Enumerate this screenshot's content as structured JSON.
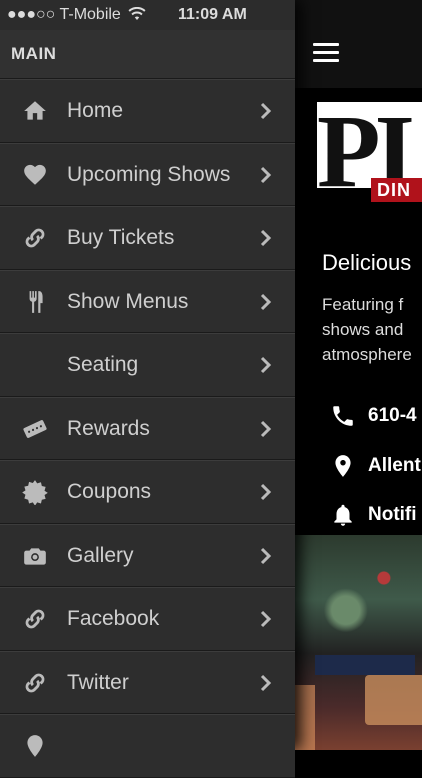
{
  "status_bar": {
    "carrier": "●●●○○ T-Mobile",
    "time": "11:09 AM"
  },
  "drawer": {
    "section_title": "MAIN",
    "items": [
      {
        "label": "Home",
        "icon": "home-icon"
      },
      {
        "label": "Upcoming Shows",
        "icon": "heart-icon"
      },
      {
        "label": "Buy Tickets",
        "icon": "link-icon"
      },
      {
        "label": "Show Menus",
        "icon": "fork-knife-icon"
      },
      {
        "label": "Seating",
        "icon": ""
      },
      {
        "label": "Rewards",
        "icon": "ticket-icon"
      },
      {
        "label": "Coupons",
        "icon": "badge-icon"
      },
      {
        "label": "Gallery",
        "icon": "camera-icon"
      },
      {
        "label": "Facebook",
        "icon": "link-icon"
      },
      {
        "label": "Twitter",
        "icon": "link-icon"
      }
    ]
  },
  "content": {
    "logo_text": "PI",
    "logo_subtext": "DIN",
    "tagline": "Delicious",
    "description": [
      "Featuring f",
      "shows and",
      "atmosphere"
    ],
    "phone": "610-4",
    "location": "Allent",
    "notifications": "Notifi"
  },
  "colors": {
    "drawer_bg": "#2d2d2d",
    "logo_red": "#b0121b",
    "text_light": "#cfcfcf"
  }
}
